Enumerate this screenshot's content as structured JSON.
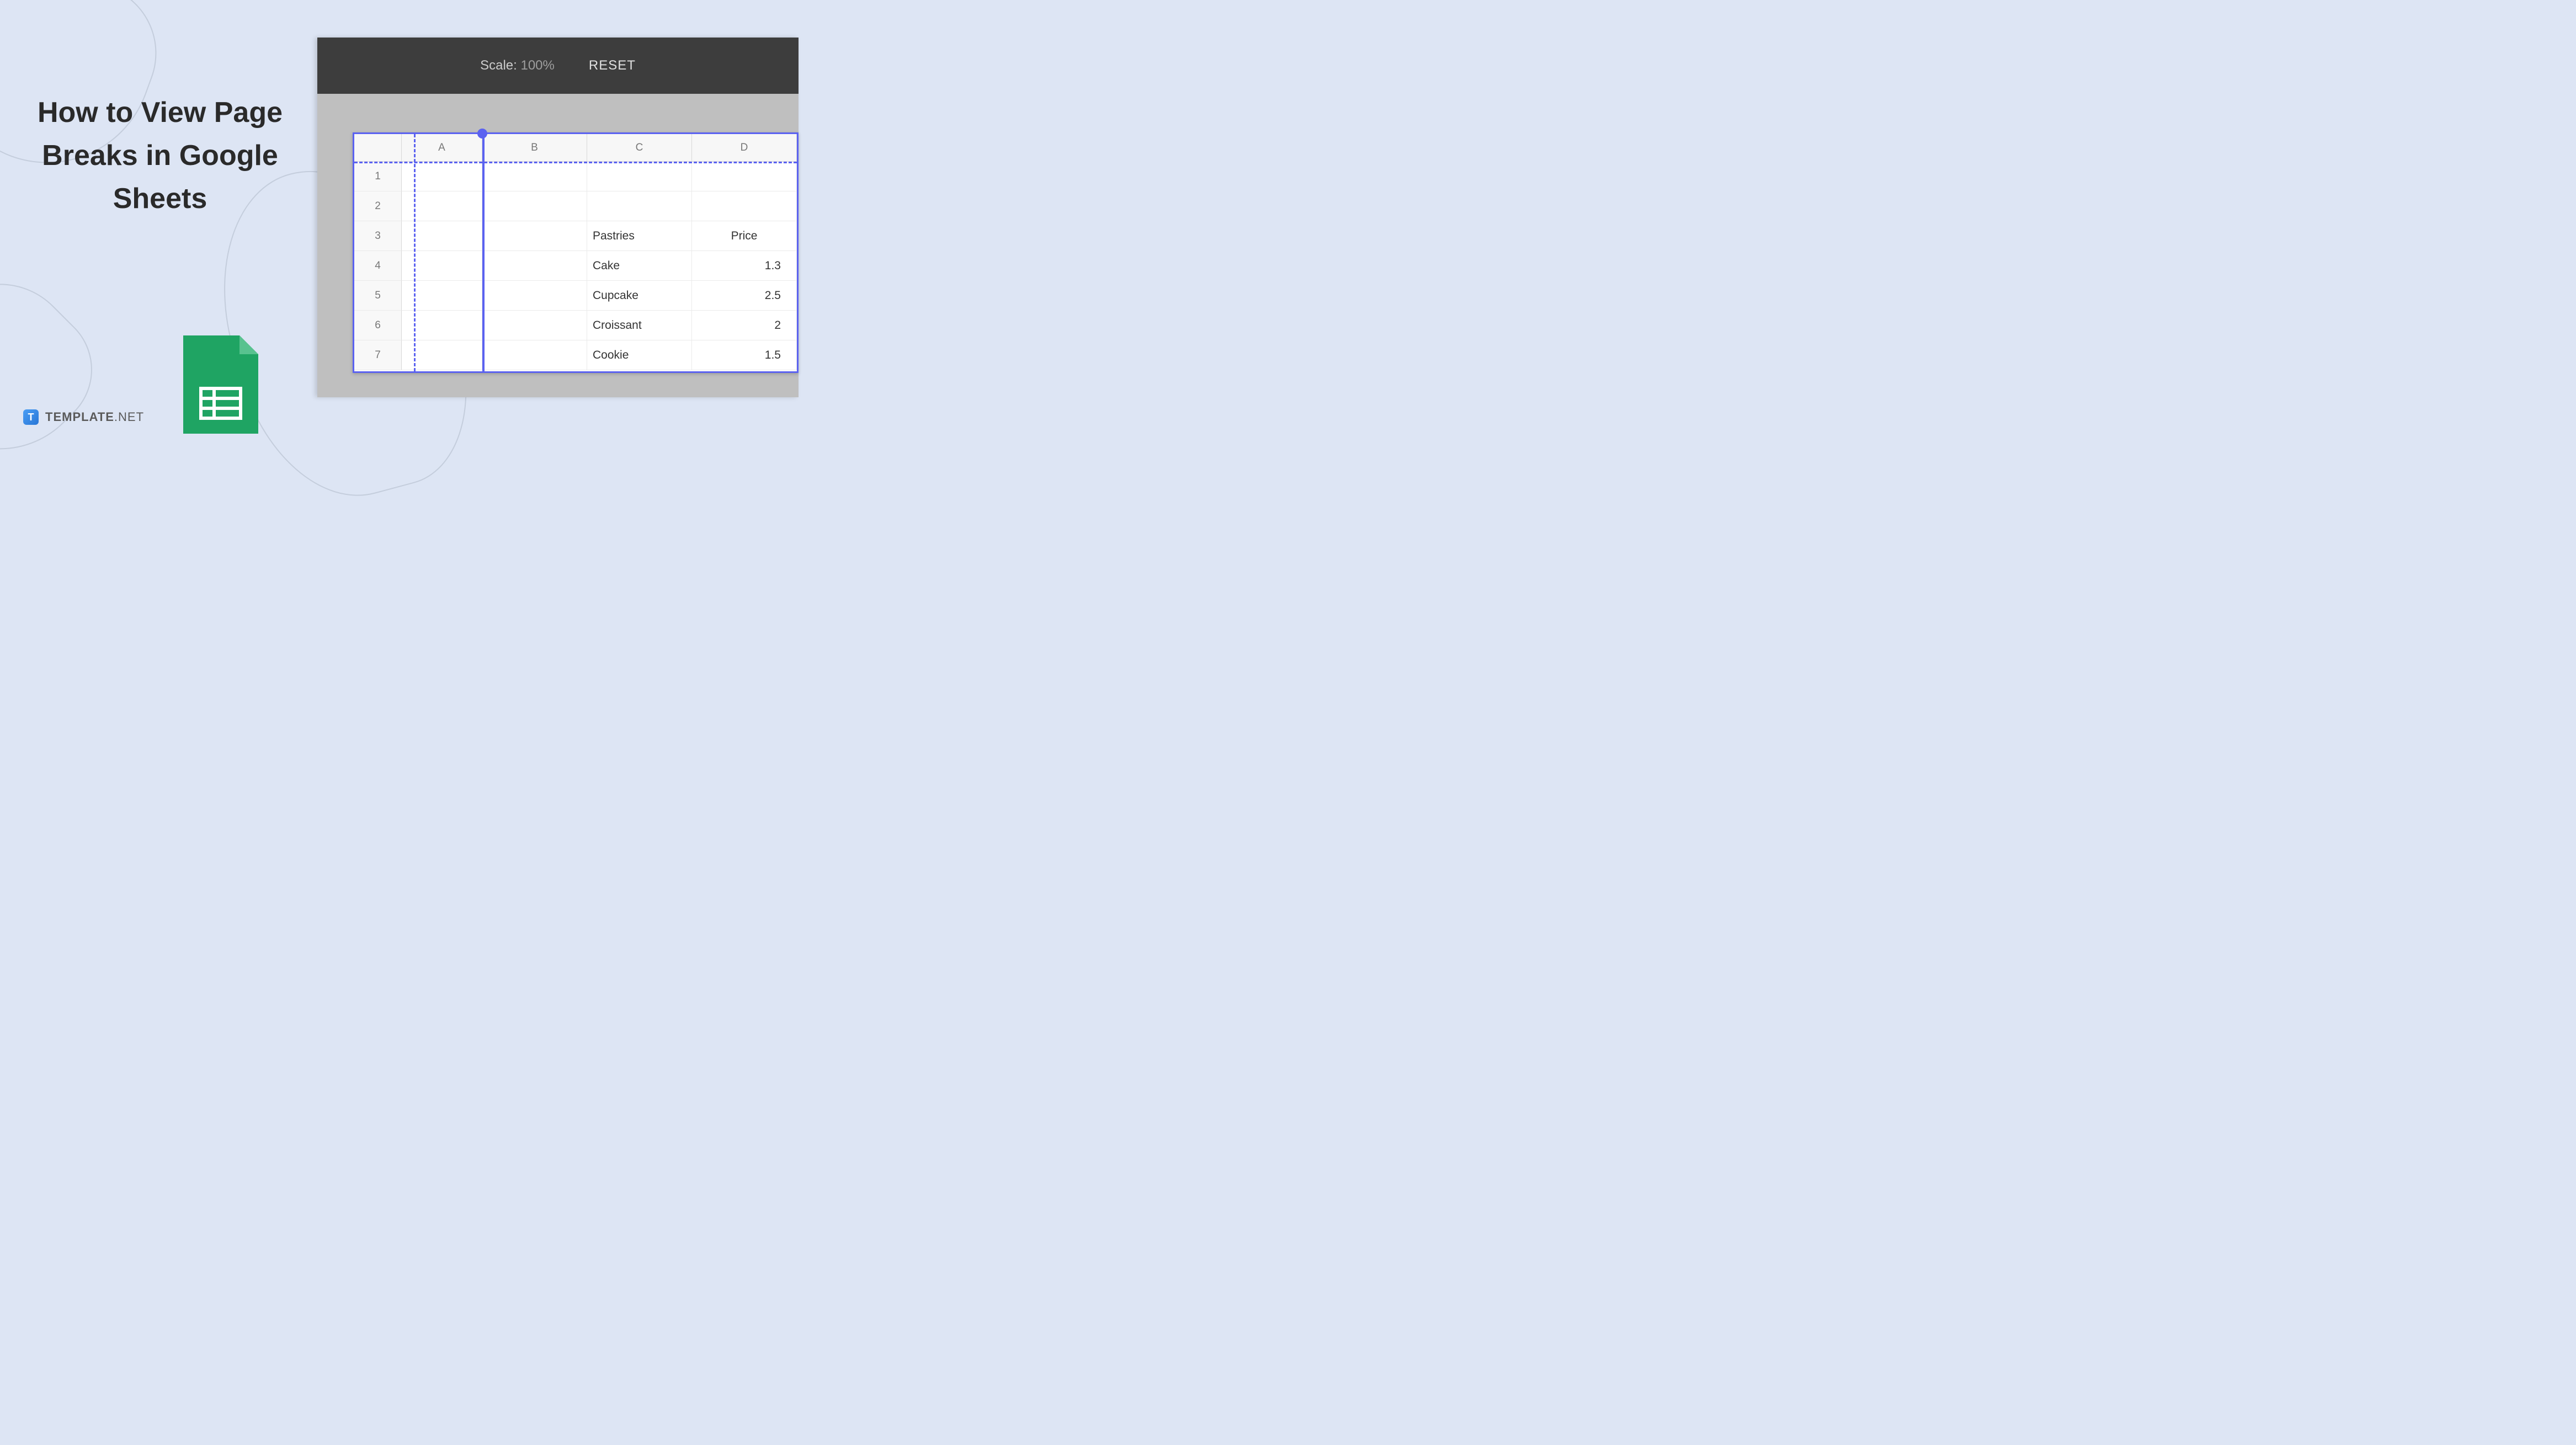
{
  "page_title": "How to View Page Breaks in Google Sheets",
  "brand": {
    "icon_letter": "T",
    "name": "TEMPLATE",
    "suffix": ".NET"
  },
  "toolbar": {
    "scale_label": "Scale:",
    "scale_value": "100%",
    "reset_label": "RESET"
  },
  "sheet": {
    "columns": [
      "A",
      "B",
      "C",
      "D"
    ],
    "rows": [
      "1",
      "2",
      "3",
      "4",
      "5",
      "6",
      "7"
    ],
    "cells": {
      "c3": "Pastries",
      "d3": "Price",
      "c4": "Cake",
      "d4": "1.3",
      "c5": "Cupcake",
      "d5": "2.5",
      "c6": "Croissant",
      "d6": "2",
      "c7": "Cookie",
      "d7": "1.5"
    }
  },
  "icon_names": {
    "sheets": "google-sheets-icon",
    "template": "template-logo-icon"
  }
}
